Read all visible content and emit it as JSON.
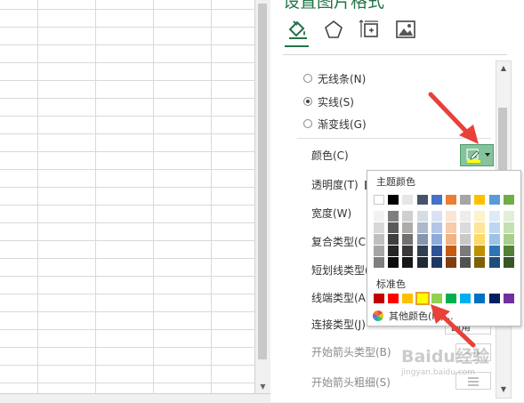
{
  "pane": {
    "title": "设置图片格式",
    "tabs": [
      {
        "icon": "fill-line-icon",
        "active": true
      },
      {
        "icon": "effects-pentagon-icon"
      },
      {
        "icon": "size-properties-icon"
      },
      {
        "icon": "picture-icon"
      }
    ],
    "line_options": [
      {
        "label": "无线条(N)",
        "checked": false
      },
      {
        "label": "实线(S)",
        "checked": true
      },
      {
        "label": "渐变线(G)",
        "checked": false
      }
    ],
    "properties": {
      "color": "颜色(C)",
      "transparency": "透明度(T)",
      "width": "宽度(W)",
      "compound_type": "复合类型(C)",
      "dash_type": "短划线类型(D)",
      "cap_type": "线端类型(A)",
      "join_type": "连接类型(J)",
      "begin_arrow_type": "开始箭头类型(B)",
      "begin_arrow_size": "开始箭头粗细(S)"
    },
    "join_value": "圆角",
    "color_button_accent": "#84c39b"
  },
  "popup": {
    "theme_label": "主题颜色",
    "standard_label": "标准色",
    "more_colors": "其他颜色(M)...",
    "theme_top": [
      "#ffffff",
      "#000000",
      "#e7e6e6",
      "#44546a",
      "#4472c4",
      "#ed7d31",
      "#a5a5a5",
      "#ffc000",
      "#5b9bd5",
      "#70ad47"
    ],
    "theme_shades": [
      [
        "#f2f2f2",
        "#7f7f7f",
        "#d0cece",
        "#d6dce4",
        "#d9e2f3",
        "#fbe5d5",
        "#ededed",
        "#fff2cc",
        "#deebf6",
        "#e2efd9"
      ],
      [
        "#d8d8d8",
        "#595959",
        "#aeabab",
        "#adb9ca",
        "#b4c6e7",
        "#f7cbac",
        "#dbdbdb",
        "#fee599",
        "#bdd7ee",
        "#c5e0b3"
      ],
      [
        "#bfbfbf",
        "#3f3f3f",
        "#757070",
        "#8496b0",
        "#8eaadb",
        "#f4b183",
        "#c9c9c9",
        "#ffd965",
        "#9cc3e5",
        "#a8d08d"
      ],
      [
        "#a5a5a5",
        "#262626",
        "#3a3838",
        "#323f4f",
        "#2f5496",
        "#c55a11",
        "#7b7b7b",
        "#bf9000",
        "#2e75b5",
        "#538135"
      ],
      [
        "#7f7f7f",
        "#0c0c0c",
        "#171616",
        "#222a35",
        "#1f3864",
        "#833c0b",
        "#525252",
        "#7f6000",
        "#1e4e79",
        "#375623"
      ]
    ],
    "standard": [
      "#c00000",
      "#ff0000",
      "#ffc000",
      "#ffff00",
      "#92d050",
      "#00b050",
      "#00b0f0",
      "#0070c0",
      "#002060",
      "#7030a0"
    ],
    "standard_selected_index": 3
  },
  "watermark": {
    "text": "Baidu经验",
    "sub": "jingyan.baidu.com"
  }
}
